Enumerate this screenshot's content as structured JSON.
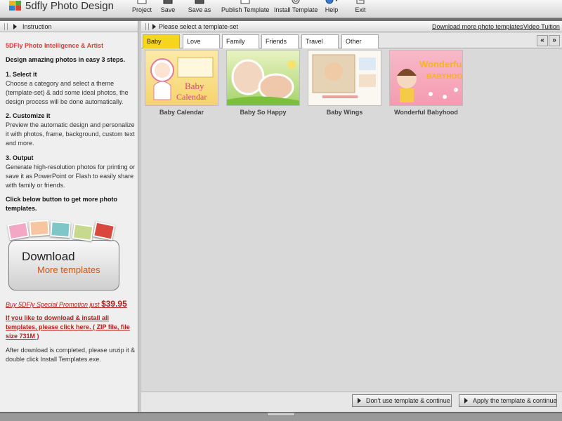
{
  "app": {
    "title": "5dfly Photo Design"
  },
  "toolbar": {
    "items": [
      {
        "label": "Project",
        "icon": "project-icon"
      },
      {
        "label": "Save",
        "icon": "save-icon"
      },
      {
        "label": "Save as",
        "icon": "save-as-icon"
      },
      {
        "label": "Publish Template",
        "icon": "publish-icon"
      },
      {
        "label": "Install Template",
        "icon": "install-icon"
      },
      {
        "label": "Help",
        "icon": "help-icon"
      },
      {
        "label": "Exit",
        "icon": "exit-icon"
      }
    ]
  },
  "instruction": {
    "header": "Instruction",
    "brand": "5DFly Photo Intelligence & Artist",
    "intro": "Design amazing photos in easy 3 steps.",
    "step1_title": "1. Select it",
    "step1_text": "Choose a category and select a theme (template-set) & add some ideal photos, the design process will be done automatically.",
    "step2_title": "2. Customize it",
    "step2_text": "Preview the automatic design and personalize it with photos, frame, background, custom text and more.",
    "step3_title": "3. Output",
    "step3_text": "Generate high-resolution photos for printing or save it as PowerPoint or Flash to easily share with family or friends.",
    "cta": "Click below button to get more photo templates.",
    "download_main": "Download",
    "download_sub": "More templates",
    "promo_text": "Buy 5DFly Special Promotion just ",
    "promo_price": "$39.95",
    "download_all": "If you like to download & install all templates, please click here. ( ZIP file, file size 731M )",
    "after_note": "After download is completed, please unzip it & double click Install Templates.exe."
  },
  "template_panel": {
    "header": "Please select a template-set",
    "link_more": "Download more photo templates",
    "link_video": "Video Tuition",
    "tabs": [
      "Baby",
      "Love",
      "Family",
      "Friends",
      "Travel",
      "Other"
    ],
    "active_tab": "Baby",
    "nav_prev": "«",
    "nav_next": "»",
    "templates": [
      {
        "name": "Baby Calendar",
        "art_text": "Baby Calendar"
      },
      {
        "name": "Baby So Happy",
        "art_text": ""
      },
      {
        "name": "Baby Wings",
        "art_text": ""
      },
      {
        "name": "Wonderful Babyhood",
        "art_text": "Wonderful BABYHOOD"
      }
    ],
    "btn_dont_use": "Don't use template & continue",
    "btn_apply": "Apply the template & continue"
  },
  "colors": {
    "active_tab": "#f7d51c",
    "brand_red": "#e03a3a",
    "link_red": "#b42020"
  }
}
